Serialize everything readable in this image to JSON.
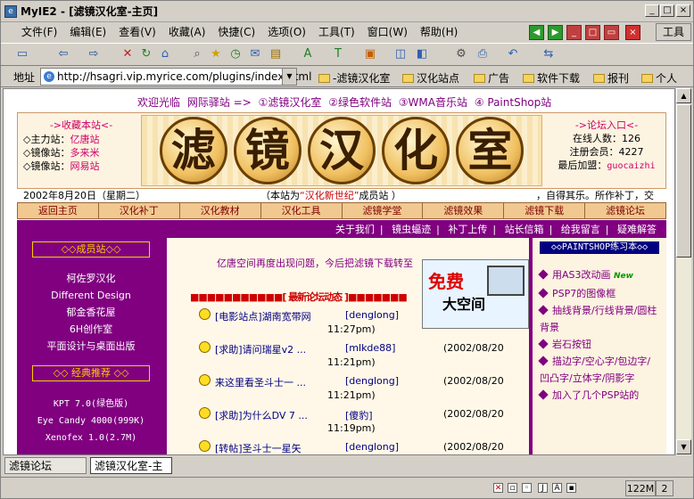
{
  "window": {
    "title": "MyIE2 - [滤镜汉化室-主页]",
    "minimize": "_",
    "maximize": "□",
    "close": "×"
  },
  "menu": [
    "文件(F)",
    "编辑(E)",
    "查看(V)",
    "收藏(A)",
    "快捷(C)",
    "选项(O)",
    "工具(T)",
    "窗口(W)",
    "帮助(H)"
  ],
  "tools_label": "工具",
  "address": {
    "label": "地址",
    "url": "http://hsagri.vip.myrice.com/plugins/index.html"
  },
  "favorites": [
    "-滤镜汉化室",
    "汉化站点",
    "广告",
    "软件下载",
    "报刊",
    "个人"
  ],
  "page": {
    "welcome": [
      "欢迎光临",
      "网际驿站 =>",
      "①滤镜汉化室",
      "②绿色软件站",
      "③WMA音乐站",
      "④ PaintShop站"
    ],
    "bookmark": {
      "title": "->收藏本站<-",
      "rows": [
        {
          "label": "◇主力站：",
          "value": "亿唐站"
        },
        {
          "label": "◇镜像站：",
          "value": "多来米"
        },
        {
          "label": "◇镜像站：",
          "value": "网易站"
        }
      ]
    },
    "logo_chars": [
      "滤",
      "镜",
      "汉",
      "化",
      "室"
    ],
    "forum": {
      "title": "->论坛入口<-",
      "online": "在线人数：126",
      "members": "注册会员：4227",
      "latest_label": "最后加盟：",
      "latest_user": "guocaizhi"
    },
    "date": "2002年8月20日（星期二）",
    "belong": {
      "prefix": "（本站为",
      "name": "“汉化新世纪”",
      "suffix": "成员站 ）"
    },
    "marquee": "，自得其乐。所作补丁，交",
    "nav": [
      "返回主页",
      "汉化补丁",
      "汉化教材",
      "汉化工具",
      "滤镜学堂",
      "滤镜效果",
      "滤镜下载",
      "滤镜论坛"
    ],
    "sublinks": [
      "关于我们",
      "|",
      "镜虫蝠迹",
      "|",
      "补丁上传",
      "|",
      "站长信箱",
      "|",
      "给我留言",
      "|",
      "疑难解答"
    ],
    "member_title": "◇◇成员站◇◇",
    "members": [
      "柯佐罗汉化",
      "Different Design",
      "郁金香花屋",
      "6H创作室",
      "平面设计与桌面出版"
    ],
    "classic_title": "◇◇ 经典推荐 ◇◇",
    "classics": [
      "KPT 7.0(绿色版)",
      "Eye Candy 4000(999K)",
      "Xenofex 1.0(2.7M)"
    ],
    "notice": "亿唐空间再度出现问题，今后把滤镜下载转至",
    "section_title": "■■■■■■■■■■■[  最新论坛动态  ]■■■■■■■",
    "posts": [
      {
        "title": "[电影站点]湖南宽带网",
        "author": "[denglong]",
        "date": "",
        "time": "11:27pm)"
      },
      {
        "title": "[求助]请问瑞星v2 ...",
        "author": "[mlkde88]",
        "date": "(2002/08/20",
        "time": "11:21pm)"
      },
      {
        "title": "来这里看圣斗士一 ...",
        "author": "[denglong]",
        "date": "(2002/08/20",
        "time": "11:21pm)"
      },
      {
        "title": "[求助]为什么DV 7 ...",
        "author": "[傻豹]",
        "date": "(2002/08/20",
        "time": "11:19pm)"
      },
      {
        "title": "[转帖]圣斗士一星矢",
        "author": "[denglong]",
        "date": "(2002/08/20",
        "time": ""
      }
    ],
    "ad": {
      "line1": "免费",
      "line2": "大空间"
    },
    "right_title": "◇◇PAINTSHOP练习本◇◇",
    "right_items": [
      {
        "text": "用AS3改动画",
        "new": "New"
      },
      {
        "text": "PSP7的图像框",
        "new": ""
      },
      {
        "text": "抽线背景/行线背景/圆柱背景",
        "new": ""
      },
      {
        "text": "岩石按钮",
        "new": ""
      },
      {
        "text": "描边字/空心字/包边字/凹凸字/立体字/阴影字",
        "new": ""
      },
      {
        "text": "加入了几个PSP站的",
        "new": ""
      }
    ]
  },
  "tabs": [
    "滤镜论坛",
    "滤镜汉化室-主"
  ],
  "status": {
    "memory": "122M",
    "percent": "2"
  }
}
